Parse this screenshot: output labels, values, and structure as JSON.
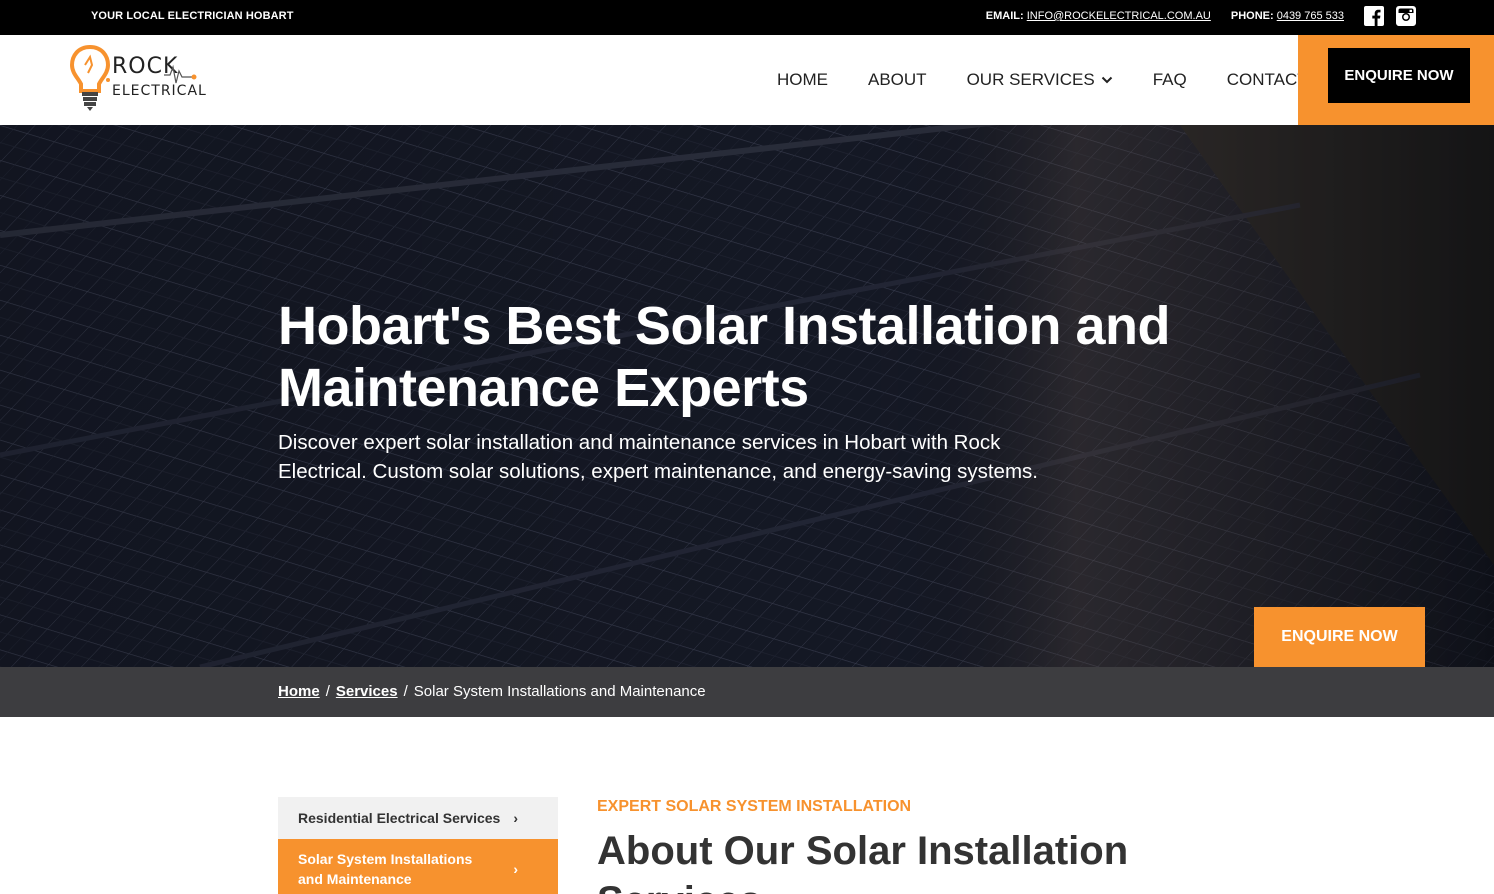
{
  "topbar": {
    "tagline": "YOUR LOCAL ELECTRICIAN HOBART",
    "email_label": "EMAIL:",
    "email": "INFO@ROCKELECTRICAL.COM.AU",
    "phone_label": "PHONE:",
    "phone": "0439 765 533"
  },
  "logo": {
    "line1": "ROCK",
    "line2": "ELECTRICAL"
  },
  "nav": {
    "home": "HOME",
    "about": "ABOUT",
    "services": "OUR SERVICES",
    "faq": "FAQ",
    "contact": "CONTACT",
    "enquire": "ENQUIRE NOW"
  },
  "hero": {
    "title": "Hobart's Best Solar Installation and Maintenance Experts",
    "subtitle": "Discover expert solar installation and maintenance services in Hobart with Rock Electrical. Custom solar solutions, expert maintenance, and energy-saving systems.",
    "cta": "ENQUIRE NOW"
  },
  "breadcrumb": {
    "home": "Home",
    "services": "Services",
    "current": "Solar System Installations and Maintenance",
    "sep": "/"
  },
  "sidebar": {
    "items": [
      {
        "label": "Residential Electrical Services"
      },
      {
        "label": "Solar System Installations and Maintenance"
      }
    ],
    "chevron": "›"
  },
  "content": {
    "eyebrow": "EXPERT SOLAR SYSTEM INSTALLATION",
    "title": "About Our Solar Installation Services"
  },
  "colors": {
    "accent": "#f7922e",
    "dark": "#000000",
    "breadcrumb_bg": "#3d3d40"
  }
}
